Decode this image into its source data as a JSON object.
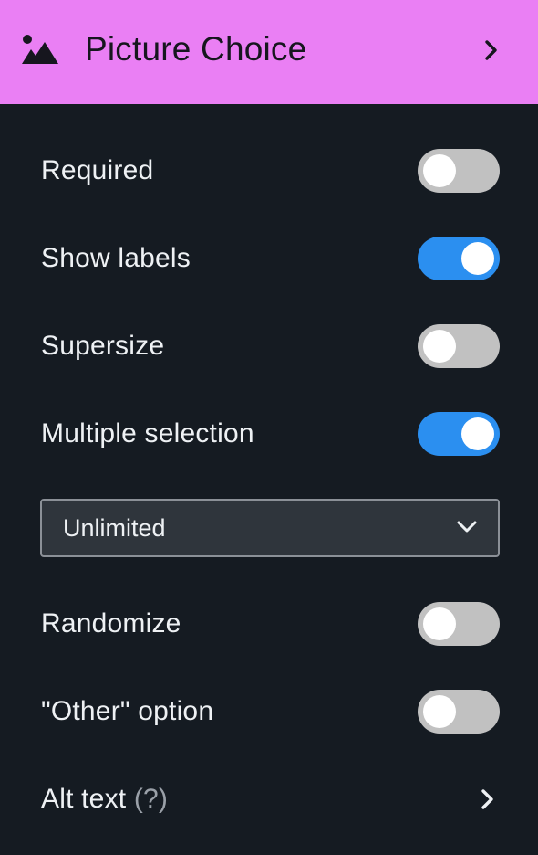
{
  "header": {
    "title": "Picture Choice",
    "icon": "picture-icon",
    "background": "#ea7ff4"
  },
  "settings": {
    "required": {
      "label": "Required",
      "on": false
    },
    "show_labels": {
      "label": "Show labels",
      "on": true
    },
    "supersize": {
      "label": "Supersize",
      "on": false
    },
    "multiple_selection": {
      "label": "Multiple selection",
      "on": true
    },
    "selection_limit": {
      "value": "Unlimited"
    },
    "randomize": {
      "label": "Randomize",
      "on": false
    },
    "other_option": {
      "label": "\"Other\" option",
      "on": false
    },
    "alt_text": {
      "label": "Alt text",
      "hint": "(?)"
    }
  },
  "colors": {
    "panel_background": "#151b22",
    "toggle_on": "#2b8ff0",
    "toggle_off": "#c1c1c1"
  }
}
